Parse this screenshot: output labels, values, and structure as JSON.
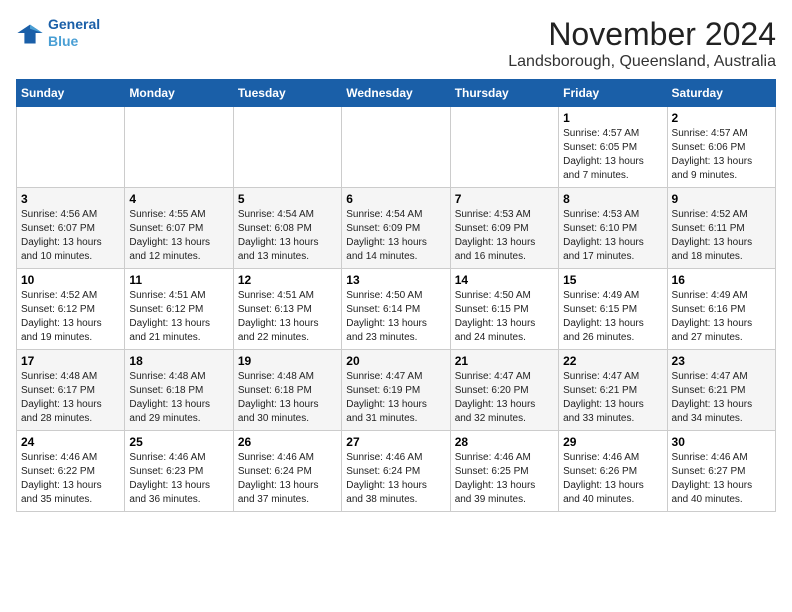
{
  "logo": {
    "line1": "General",
    "line2": "Blue"
  },
  "title": "November 2024",
  "subtitle": "Landsborough, Queensland, Australia",
  "weekdays": [
    "Sunday",
    "Monday",
    "Tuesday",
    "Wednesday",
    "Thursday",
    "Friday",
    "Saturday"
  ],
  "weeks": [
    [
      {
        "day": "",
        "sunrise": "",
        "sunset": "",
        "daylight": ""
      },
      {
        "day": "",
        "sunrise": "",
        "sunset": "",
        "daylight": ""
      },
      {
        "day": "",
        "sunrise": "",
        "sunset": "",
        "daylight": ""
      },
      {
        "day": "",
        "sunrise": "",
        "sunset": "",
        "daylight": ""
      },
      {
        "day": "",
        "sunrise": "",
        "sunset": "",
        "daylight": ""
      },
      {
        "day": "1",
        "sunrise": "Sunrise: 4:57 AM",
        "sunset": "Sunset: 6:05 PM",
        "daylight": "Daylight: 13 hours and 7 minutes."
      },
      {
        "day": "2",
        "sunrise": "Sunrise: 4:57 AM",
        "sunset": "Sunset: 6:06 PM",
        "daylight": "Daylight: 13 hours and 9 minutes."
      }
    ],
    [
      {
        "day": "3",
        "sunrise": "Sunrise: 4:56 AM",
        "sunset": "Sunset: 6:07 PM",
        "daylight": "Daylight: 13 hours and 10 minutes."
      },
      {
        "day": "4",
        "sunrise": "Sunrise: 4:55 AM",
        "sunset": "Sunset: 6:07 PM",
        "daylight": "Daylight: 13 hours and 12 minutes."
      },
      {
        "day": "5",
        "sunrise": "Sunrise: 4:54 AM",
        "sunset": "Sunset: 6:08 PM",
        "daylight": "Daylight: 13 hours and 13 minutes."
      },
      {
        "day": "6",
        "sunrise": "Sunrise: 4:54 AM",
        "sunset": "Sunset: 6:09 PM",
        "daylight": "Daylight: 13 hours and 14 minutes."
      },
      {
        "day": "7",
        "sunrise": "Sunrise: 4:53 AM",
        "sunset": "Sunset: 6:09 PM",
        "daylight": "Daylight: 13 hours and 16 minutes."
      },
      {
        "day": "8",
        "sunrise": "Sunrise: 4:53 AM",
        "sunset": "Sunset: 6:10 PM",
        "daylight": "Daylight: 13 hours and 17 minutes."
      },
      {
        "day": "9",
        "sunrise": "Sunrise: 4:52 AM",
        "sunset": "Sunset: 6:11 PM",
        "daylight": "Daylight: 13 hours and 18 minutes."
      }
    ],
    [
      {
        "day": "10",
        "sunrise": "Sunrise: 4:52 AM",
        "sunset": "Sunset: 6:12 PM",
        "daylight": "Daylight: 13 hours and 19 minutes."
      },
      {
        "day": "11",
        "sunrise": "Sunrise: 4:51 AM",
        "sunset": "Sunset: 6:12 PM",
        "daylight": "Daylight: 13 hours and 21 minutes."
      },
      {
        "day": "12",
        "sunrise": "Sunrise: 4:51 AM",
        "sunset": "Sunset: 6:13 PM",
        "daylight": "Daylight: 13 hours and 22 minutes."
      },
      {
        "day": "13",
        "sunrise": "Sunrise: 4:50 AM",
        "sunset": "Sunset: 6:14 PM",
        "daylight": "Daylight: 13 hours and 23 minutes."
      },
      {
        "day": "14",
        "sunrise": "Sunrise: 4:50 AM",
        "sunset": "Sunset: 6:15 PM",
        "daylight": "Daylight: 13 hours and 24 minutes."
      },
      {
        "day": "15",
        "sunrise": "Sunrise: 4:49 AM",
        "sunset": "Sunset: 6:15 PM",
        "daylight": "Daylight: 13 hours and 26 minutes."
      },
      {
        "day": "16",
        "sunrise": "Sunrise: 4:49 AM",
        "sunset": "Sunset: 6:16 PM",
        "daylight": "Daylight: 13 hours and 27 minutes."
      }
    ],
    [
      {
        "day": "17",
        "sunrise": "Sunrise: 4:48 AM",
        "sunset": "Sunset: 6:17 PM",
        "daylight": "Daylight: 13 hours and 28 minutes."
      },
      {
        "day": "18",
        "sunrise": "Sunrise: 4:48 AM",
        "sunset": "Sunset: 6:18 PM",
        "daylight": "Daylight: 13 hours and 29 minutes."
      },
      {
        "day": "19",
        "sunrise": "Sunrise: 4:48 AM",
        "sunset": "Sunset: 6:18 PM",
        "daylight": "Daylight: 13 hours and 30 minutes."
      },
      {
        "day": "20",
        "sunrise": "Sunrise: 4:47 AM",
        "sunset": "Sunset: 6:19 PM",
        "daylight": "Daylight: 13 hours and 31 minutes."
      },
      {
        "day": "21",
        "sunrise": "Sunrise: 4:47 AM",
        "sunset": "Sunset: 6:20 PM",
        "daylight": "Daylight: 13 hours and 32 minutes."
      },
      {
        "day": "22",
        "sunrise": "Sunrise: 4:47 AM",
        "sunset": "Sunset: 6:21 PM",
        "daylight": "Daylight: 13 hours and 33 minutes."
      },
      {
        "day": "23",
        "sunrise": "Sunrise: 4:47 AM",
        "sunset": "Sunset: 6:21 PM",
        "daylight": "Daylight: 13 hours and 34 minutes."
      }
    ],
    [
      {
        "day": "24",
        "sunrise": "Sunrise: 4:46 AM",
        "sunset": "Sunset: 6:22 PM",
        "daylight": "Daylight: 13 hours and 35 minutes."
      },
      {
        "day": "25",
        "sunrise": "Sunrise: 4:46 AM",
        "sunset": "Sunset: 6:23 PM",
        "daylight": "Daylight: 13 hours and 36 minutes."
      },
      {
        "day": "26",
        "sunrise": "Sunrise: 4:46 AM",
        "sunset": "Sunset: 6:24 PM",
        "daylight": "Daylight: 13 hours and 37 minutes."
      },
      {
        "day": "27",
        "sunrise": "Sunrise: 4:46 AM",
        "sunset": "Sunset: 6:24 PM",
        "daylight": "Daylight: 13 hours and 38 minutes."
      },
      {
        "day": "28",
        "sunrise": "Sunrise: 4:46 AM",
        "sunset": "Sunset: 6:25 PM",
        "daylight": "Daylight: 13 hours and 39 minutes."
      },
      {
        "day": "29",
        "sunrise": "Sunrise: 4:46 AM",
        "sunset": "Sunset: 6:26 PM",
        "daylight": "Daylight: 13 hours and 40 minutes."
      },
      {
        "day": "30",
        "sunrise": "Sunrise: 4:46 AM",
        "sunset": "Sunset: 6:27 PM",
        "daylight": "Daylight: 13 hours and 40 minutes."
      }
    ]
  ]
}
